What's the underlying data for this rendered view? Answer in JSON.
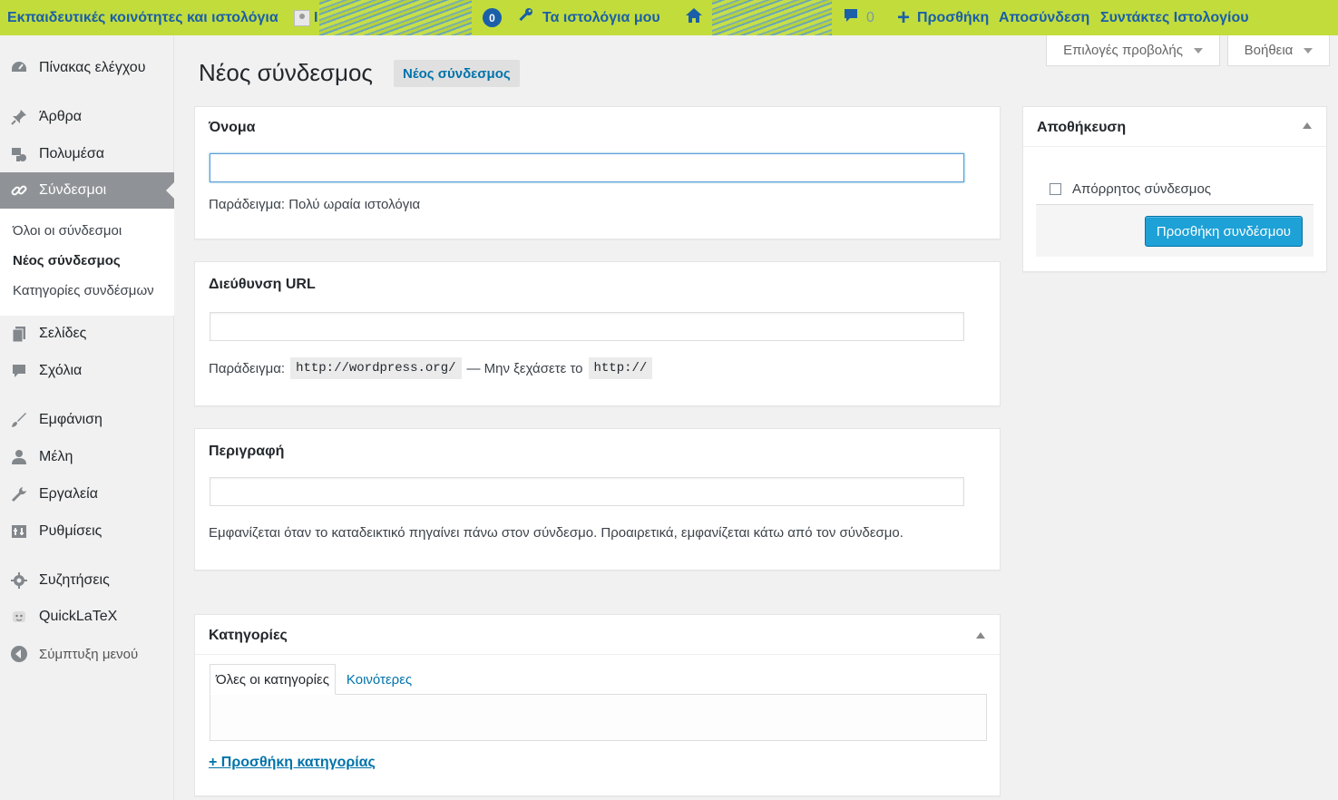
{
  "adminbar": {
    "site_name": "Εκπαιδευτικές κοινότητες και ιστολόγια",
    "avatar_initial": "I",
    "notification_count": "0",
    "my_blogs": "Τα ιστολόγια μου",
    "comments_count": "0",
    "add_new": "Προσθήκη",
    "logout": "Αποσύνδεση",
    "blog_editors": "Συντάκτες Ιστολογίου"
  },
  "sidebar": {
    "items": [
      {
        "label": "Πίνακας ελέγχου",
        "icon": "dashboard-icon"
      },
      {
        "label": "Άρθρα",
        "icon": "pin-icon"
      },
      {
        "label": "Πολυμέσα",
        "icon": "media-icon"
      },
      {
        "label": "Σύνδεσμοι",
        "icon": "link-icon"
      },
      {
        "label": "Σελίδες",
        "icon": "pages-icon"
      },
      {
        "label": "Σχόλια",
        "icon": "comment-icon"
      },
      {
        "label": "Εμφάνιση",
        "icon": "brush-icon"
      },
      {
        "label": "Μέλη",
        "icon": "user-icon"
      },
      {
        "label": "Εργαλεία",
        "icon": "wrench-icon"
      },
      {
        "label": "Ρυθμίσεις",
        "icon": "settings-icon"
      },
      {
        "label": "Συζητήσεις",
        "icon": "gear-icon"
      },
      {
        "label": "QuickLaTeX",
        "icon": "latex-icon"
      },
      {
        "label": "Σύμπτυξη μενού",
        "icon": "collapse-icon"
      }
    ],
    "submenu": [
      {
        "label": "Όλοι οι σύνδεσμοι"
      },
      {
        "label": "Νέος σύνδεσμος"
      },
      {
        "label": "Κατηγορίες συνδέσμων"
      }
    ]
  },
  "screen_meta": {
    "options": "Επιλογές προβολής",
    "help": "Βοήθεια"
  },
  "page": {
    "title": "Νέος σύνδεσμος",
    "title_action": "Νέος σύνδεσμος"
  },
  "name_box": {
    "title": "Όνομα",
    "value": "",
    "help": "Παράδειγμα: Πολύ ωραία ιστολόγια"
  },
  "url_box": {
    "title": "Διεύθυνση URL",
    "value": "",
    "help_prefix": "Παράδειγμα:",
    "help_code1": "http://wordpress.org/",
    "help_middle": "— Μην ξεχάσετε το",
    "help_code2": "http://"
  },
  "desc_box": {
    "title": "Περιγραφή",
    "value": "",
    "help": "Εμφανίζεται όταν το καταδεικτικό πηγαίνει πάνω στον σύνδεσμο. Προαιρετικά, εμφανίζεται κάτω από τον σύνδεσμο."
  },
  "categories_box": {
    "title": "Κατηγορίες",
    "tab_all": "Όλες οι κατηγορίες",
    "tab_popular": "Κοινότερες",
    "add_category": "+ Προσθήκη κατηγορίας"
  },
  "save_box": {
    "title": "Αποθήκευση",
    "private_label": "Απόρρητος σύνδεσμος",
    "private_checked": false,
    "submit_label": "Προσθήκη συνδέσμου"
  }
}
